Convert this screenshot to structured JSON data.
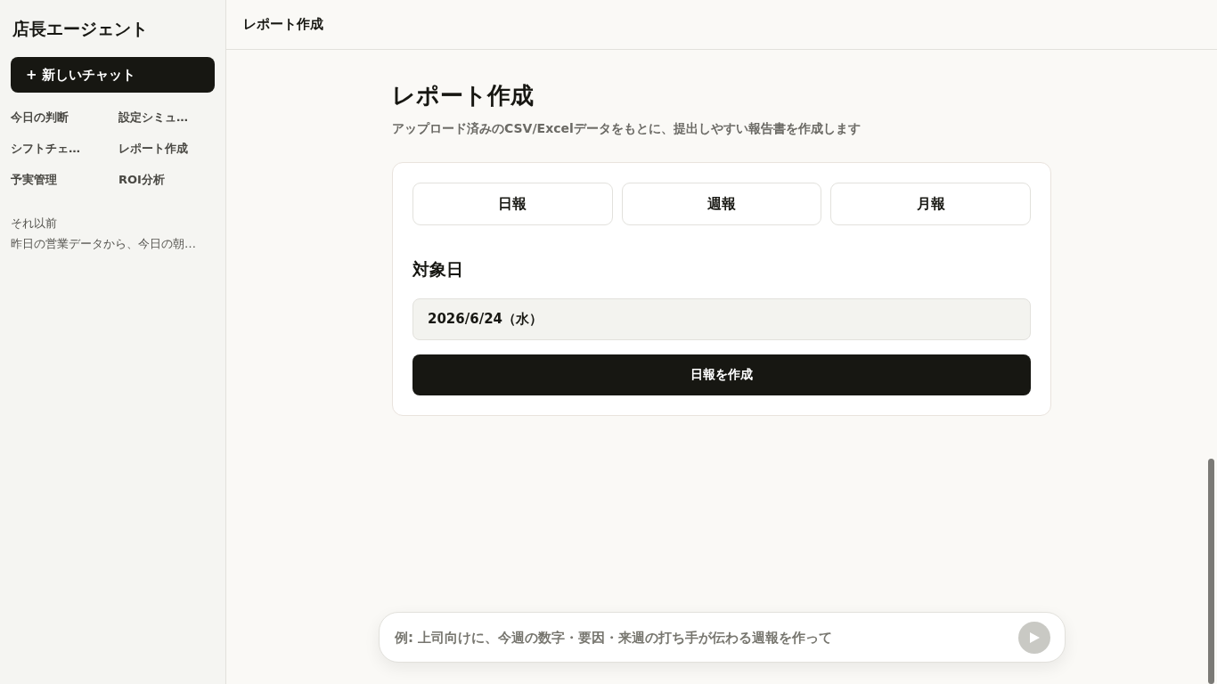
{
  "sidebar": {
    "title": "店長エージェント",
    "new_chat_button": "+ 新しいチャット",
    "items": [
      {
        "label": "今日の判断",
        "selected": false
      },
      {
        "label": "設定シミュ…",
        "selected": false
      },
      {
        "label": "シフトチェ…",
        "selected": false
      },
      {
        "label": "レポート作成",
        "selected": false
      },
      {
        "label": "予実管理",
        "selected": false
      },
      {
        "label": "ROI分析",
        "selected": false
      }
    ],
    "history": {
      "heading": "それ以前",
      "items": [
        {
          "label": "昨日の営業データから、今日の朝…",
          "selected": false
        }
      ]
    }
  },
  "header": {
    "title": "レポート作成"
  },
  "page": {
    "title": "レポート作成",
    "subtitle": "アップロード済みのCSV/Excelデータをもとに、提出しやすい報告書を作成します"
  },
  "report_card": {
    "tabs": [
      {
        "label": "日報",
        "selected": false
      },
      {
        "label": "週報",
        "selected": false
      },
      {
        "label": "月報",
        "selected": false
      }
    ],
    "date_label": "対象日",
    "date_field": {
      "value": "2026/6/24（水）"
    },
    "submit_button": "日報を作成"
  },
  "composer": {
    "placeholder": "例: 上司向けに、今週の数字・要因・来週の打ち手が伝わる週報を作って",
    "send_disabled": true
  }
}
